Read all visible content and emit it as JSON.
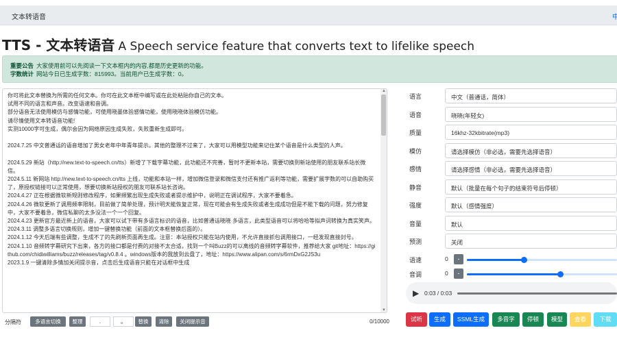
{
  "nav": {
    "brand": "文本转语音",
    "right_link": "中"
  },
  "title": {
    "main": "TTS - 文本转语音",
    "sub": "A Speech service feature that converts text to lifelike speech"
  },
  "notice": {
    "label1": "重要公告",
    "text1": "大家使用前可以先阅读一下文本框内的内容,都是历史更新的功能。",
    "label2": "字数统计",
    "text2": "网站今日已生成字数：815993。当前用户已生成字数：0。"
  },
  "textarea": {
    "content": "你可将此文本替换为所需的任何文本。你可在此文本框中编写或在此处粘贴你自己的文本。\n试用不同的语言和声音。改变语速和音调。\n部分语音无法使用模仿与感情功能，可使用晓墨体验感情功能，使用晓晓体验模仿功能。\n请尽情使用文本转语音功能!\n实测10000字可生成，偶尔会因为网络原因生成失败，失败重新生成即可。\n\n2024.7.25 中文普通话的语音增加了男女老年中年青年提示。其他的整理不过来了，大家可以用模型功能来记住某个语音是什么类型的人声。\n\n2024.5.29 新站（http://new.text-to-speech.cn/tts）新增了下载字幕功能，此功能还不完善，暂时不更新本站，需要切换到新站使用的朋友联系站长微信。\n2024.5.11 新网站 http://new.text-to-speech.cn/tts 上线，功能和本站一样，增加微信登录和微信支付还有推广返利等功能，需要扩展字数的可以自助购买了，原授权链接可以正常使用，想要切换新站授权的朋友可联系站长咨询。\n2024.4.27 正在根据微软新规则修改程序，如果频繁出现生成失败或者提示维护中，说明正在调试程序，大家不要着急。\n2024.4.26 微软更新了调用频率限制，目前做了简单处理，预计明天能恢复正常，现在可能会有生成失败或者生成成功但是不能下载的问题，努力修复中，大家不要着急，微信私聊的太多没法一个一个回复。\n2024.4.23 更新官方最近新上的语音，大家可以试下带有多语言标识的语音，比如普通话晓晓 多语言，此类型语音可以将哈哈等拟声词转换为真实笑声。\n2024.3.11 调整多语言切换规则，增加一键替换功能（前面的文本框替换后面的）。\n2024.1.12 今天后端有些调整，生成不了的先刷新页面再生成。注意：本站授权只能在站内使用，不允许直接抓包调用接口，一经发现直接封号。\n2024.1.10 音频转字幕研究下出来，各方的接口都是付费的对接不太合适，找到一个叫Buzz的可以离线的音频转字幕软件，推荐给大家 git地址：https://github.com/chidiwilliams/buzz/releases/tag/v0.8.4 。windows版本的我放到云盘了，地址：https://www.alipan.com/s/6rmDxG2JS3u\n2023.1.9 一键清除多情加关闭提示音，点击后生成语音只能在对话框中生成"
  },
  "toolbar": {
    "label": "分隔符",
    "multilang": "多语言切换",
    "replace_fmt": "整理",
    "input1": ".",
    "input2": "。",
    "replace": "替换",
    "clear": "清除",
    "close_tip": "关闭提示音",
    "counter": "0/10000"
  },
  "settings": {
    "language": {
      "label": "语言",
      "value": "中文（普通话，简体）"
    },
    "voice": {
      "label": "语音",
      "value": "晓晓(年轻女)"
    },
    "quality": {
      "label": "质量",
      "value": "16khz-32kbitrate(mp3)"
    },
    "imitate": {
      "label": "模仿",
      "value": "请选择模仿（非必选，需要先选择语音）"
    },
    "emotion": {
      "label": "感情",
      "value": "请选择感情（非必选，需要先选择语音）"
    },
    "silence": {
      "label": "静音",
      "value": "默认（批量在每个句子的结束符号后停顿）"
    },
    "strength": {
      "label": "强度",
      "value": "默认（感情强度）"
    },
    "volume": {
      "label": "音量",
      "value": "默认"
    },
    "preset": {
      "label": "预测",
      "value": "关闭"
    },
    "rate": {
      "label": "语速",
      "value": "0",
      "minus": "-",
      "level": 0.38
    },
    "pitch": {
      "label": "音调",
      "value": "0",
      "minus": "-",
      "level": 0.62
    }
  },
  "audio": {
    "time": "0:03 / 0:03"
  },
  "actions": {
    "listen": "试听",
    "generate": "生成",
    "ssml": "SSML生成",
    "multi": "多音字",
    "pause": "停顿",
    "model": "模型",
    "view": "查看",
    "download": "下载"
  },
  "colors": {
    "listen": "#dc3545",
    "primary": "#0d6efd",
    "success": "#198754",
    "warning": "#ffc107",
    "info": "#0dcaf0",
    "secondary": "#6c757d"
  }
}
